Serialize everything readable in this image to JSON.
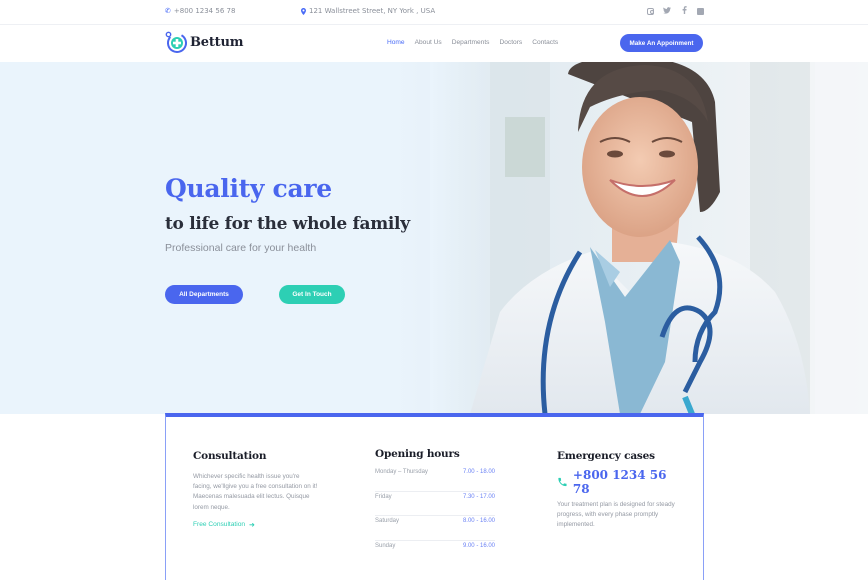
{
  "topbar": {
    "phone": "+800 1234 56 78",
    "address": "121 Wallstreet Street, NY York , USA",
    "social": [
      "instagram",
      "twitter",
      "facebook",
      "linkedin"
    ]
  },
  "header": {
    "brand": "Bettum",
    "nav": [
      {
        "label": "Home",
        "active": true
      },
      {
        "label": "About Us",
        "active": false
      },
      {
        "label": "Departments",
        "active": false
      },
      {
        "label": "Doctors",
        "active": false
      },
      {
        "label": "Contacts",
        "active": false
      }
    ],
    "cta_label": "Make An Appoinment"
  },
  "hero": {
    "title": "Quality care",
    "subtitle": "to life for the whole family",
    "tagline": "Professional care for your health",
    "primary_button": "All Departments",
    "secondary_button": "Get In Touch"
  },
  "info": {
    "consultation": {
      "title": "Consultation",
      "text": "Whichever specific health issue you're facing, we'llgive you a free consultation on it! Maecenas malesuada elit lectus. Quisque lorem neque.",
      "link": "Free Consultation"
    },
    "hours": {
      "title": "Opening hours",
      "rows": [
        {
          "day": "Monday – Thursday",
          "time": "7.00 - 18.00"
        },
        {
          "day": "Friday",
          "time": "7.30 - 17.00"
        },
        {
          "day": "Saturday",
          "time": "8.00 - 16.00"
        },
        {
          "day": "Sunday",
          "time": "9.00 - 16.00"
        }
      ]
    },
    "emergency": {
      "title": "Emergency cases",
      "phone": "+800 1234 56 78",
      "text": "Your treatment plan is designed for steady progress, with every phase promptly implemented."
    }
  },
  "colors": {
    "primary": "#4a66ee",
    "accent": "#2dcfb4",
    "hero_bg": "#eaf4fc"
  }
}
